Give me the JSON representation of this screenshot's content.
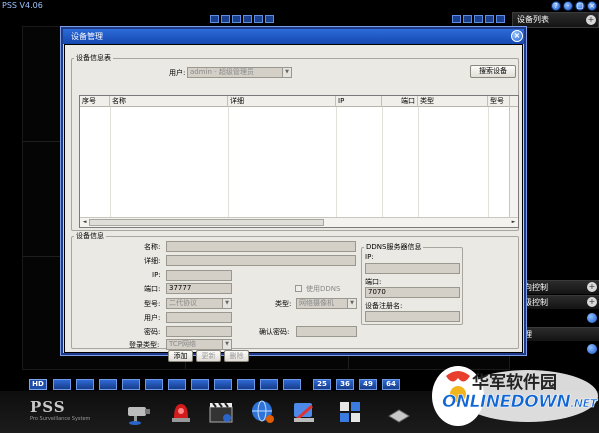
{
  "app": {
    "title": "PSS V4.06",
    "logo": "PSS",
    "logo_subtitle": "Pro Surveillance System",
    "hd_label": "HD",
    "layout_numbers": [
      "25",
      "36",
      "49",
      "64"
    ],
    "window_buttons": [
      "?",
      "-",
      "□",
      "×"
    ]
  },
  "side_panel": {
    "title": "设备列表",
    "items": [
      "方向控制",
      "高级控制",
      "管理"
    ]
  },
  "dialog": {
    "title": "设备管理",
    "close_label": "×",
    "device_info_table": {
      "legend": "设备信息表",
      "user_label": "用户:",
      "user_value": "admin - 超级管理员",
      "search_button": "搜索设备",
      "columns": [
        "序号",
        "名称",
        "详细",
        "IP",
        "端口",
        "类型",
        "型号"
      ]
    },
    "device_info": {
      "legend": "设备信息",
      "name_label": "名称:",
      "name_value": "",
      "detail_label": "详细:",
      "detail_value": "",
      "ip_label": "IP:",
      "ip_value": "",
      "port_label": "端口:",
      "port_value": "37777",
      "model_label": "型号:",
      "model_value": "二代协议",
      "user_label": "用户:",
      "user_value": "",
      "password_label": "密码:",
      "password_value": "",
      "login_type_label": "登录类型:",
      "login_type_value": "TCP网络",
      "use_ddns_label": "使用DDNS",
      "type_label": "类型:",
      "type_value": "网络摄像机",
      "confirm_password_label": "确认密码:",
      "confirm_password_value": "",
      "buttons": {
        "add": "添加",
        "update": "更新",
        "delete": "删除"
      }
    },
    "ddns": {
      "legend": "DDNS服务器信息",
      "ip_label": "IP:",
      "ip_value": "",
      "port_label": "端口:",
      "port_value": "7070",
      "reg_name_label": "设备注册名:",
      "reg_name_value": ""
    }
  },
  "watermark": {
    "cn": "华军软件园",
    "en": "ONLINEDOWN",
    "en_suffix": ".NET"
  }
}
